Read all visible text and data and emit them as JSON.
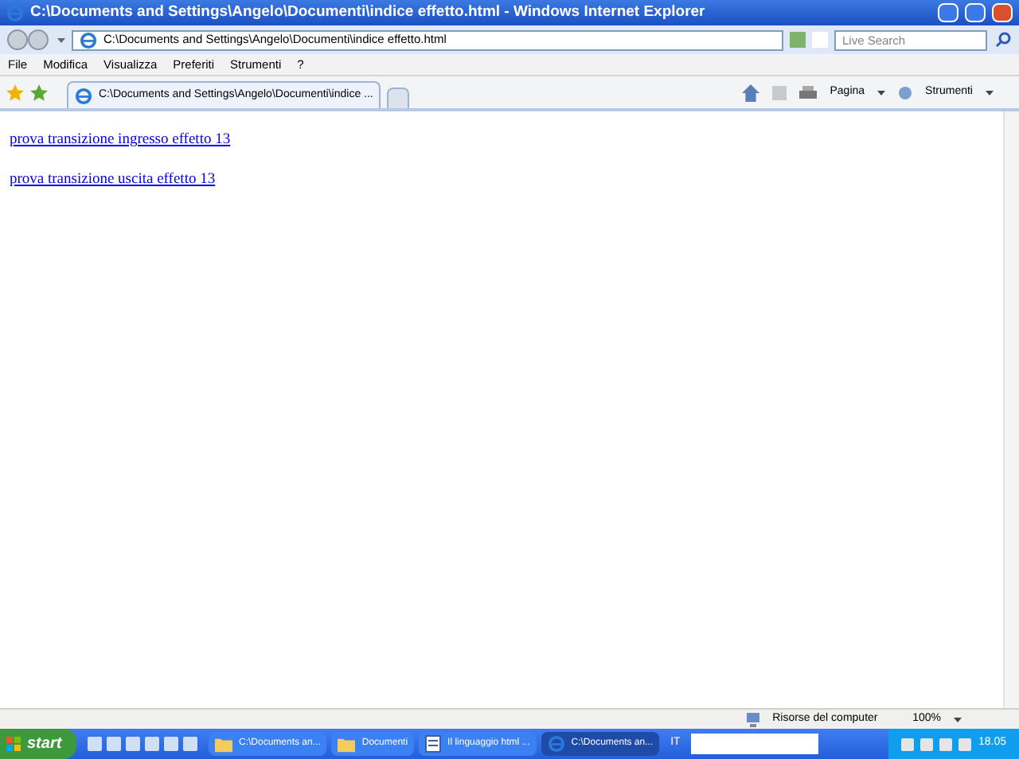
{
  "window": {
    "title": "C:\\Documents and Settings\\Angelo\\Documenti\\indice effetto.html - Windows Internet Explorer"
  },
  "address": {
    "value": "C:\\Documents and Settings\\Angelo\\Documenti\\indice effetto.html"
  },
  "search": {
    "placeholder": "Live Search"
  },
  "menu": [
    "File",
    "Modifica",
    "Visualizza",
    "Preferiti",
    "Strumenti",
    "?"
  ],
  "tabs": [
    {
      "label": "C:\\Documents and Settings\\Angelo\\Documenti\\indice ...",
      "selected": true
    }
  ],
  "toolbar": {
    "page": "Pagina",
    "tools": "Strumenti"
  },
  "links": [
    "prova transizione ingresso effetto 13",
    "prova transizione uscita effetto 13"
  ],
  "status_bar": {
    "zone": "Risorse del computer",
    "zoom": "100%"
  },
  "taskbar": {
    "start": "start",
    "buttons": [
      {
        "label": "C:\\Documents an...",
        "kind": "folder",
        "selected": false
      },
      {
        "label": "Documenti",
        "kind": "folder",
        "selected": false
      },
      {
        "label": "Il linguaggio html ...",
        "kind": "doc",
        "selected": false
      },
      {
        "label": "C:\\Documents an...",
        "kind": "ie",
        "selected": true
      }
    ],
    "language": "IT",
    "time": "18.05"
  }
}
